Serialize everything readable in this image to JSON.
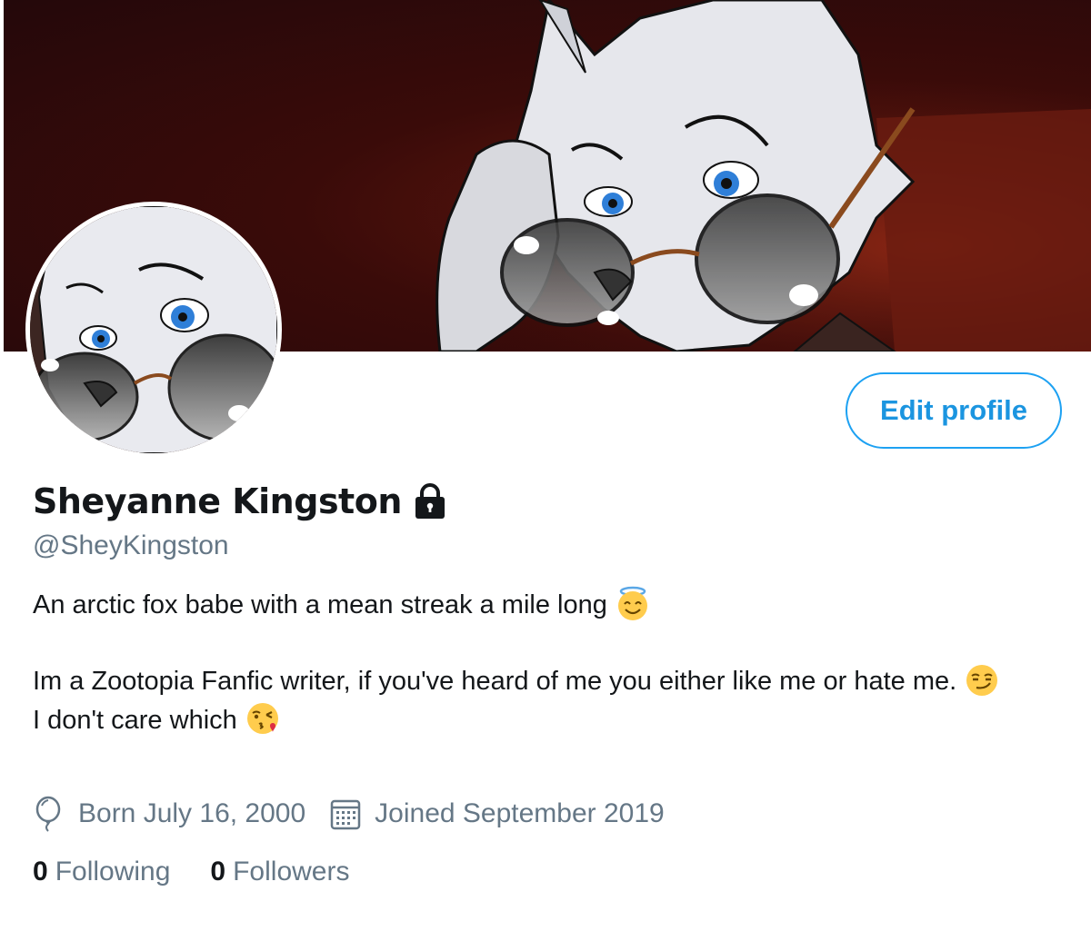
{
  "profile": {
    "display_name": "Sheyanne Kingston",
    "handle": "@SheyKingston",
    "edit_button_label": "Edit profile",
    "bio_lines": [
      "An arctic fox babe with a mean streak a mile long",
      "",
      "Im a Zootopia Fanfic writer, if you've heard of me you either like me or hate me.",
      "I don't care which"
    ],
    "birthday": "Born July 16, 2000",
    "joined": "Joined September 2019",
    "following_count": "0",
    "following_label": "Following",
    "followers_count": "0",
    "followers_label": "Followers",
    "icons": [
      "lock-icon",
      "halo-smile-emoji",
      "smirk-emoji",
      "kiss-emoji",
      "balloon-icon",
      "calendar-icon"
    ]
  },
  "colors": {
    "accent": "#1da1f2",
    "text": "#14171a",
    "muted": "#657786",
    "banner": "#3a0b09"
  }
}
